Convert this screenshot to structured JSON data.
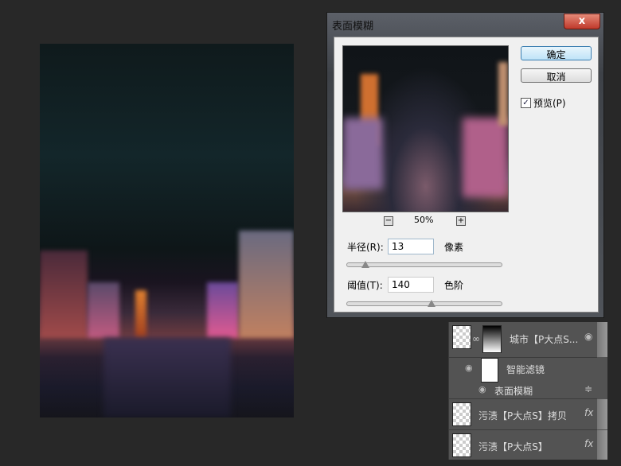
{
  "dialog": {
    "title": "表面模糊",
    "close_icon": "x",
    "ok_label": "确定",
    "cancel_label": "取消",
    "preview_label": "预览(P)",
    "preview_checked": true,
    "zoom_level": "50%",
    "zoom_out": "−",
    "zoom_in": "+",
    "radius": {
      "label": "半径(R):",
      "value": "13",
      "unit": "像素",
      "slider_fraction": 0.12
    },
    "threshold": {
      "label": "阈值(T):",
      "value": "140",
      "unit": "色阶",
      "slider_fraction": 0.55
    }
  },
  "layers": [
    {
      "name": "城市【P大点S...",
      "type": "smart-object"
    },
    {
      "name": "智能滤镜",
      "type": "smart-filter"
    },
    {
      "name": "表面模糊",
      "type": "filter"
    },
    {
      "name": "污渍【P大点S】拷贝",
      "fx": "fx"
    },
    {
      "name": "污渍【P大点S】",
      "fx": "fx"
    }
  ]
}
